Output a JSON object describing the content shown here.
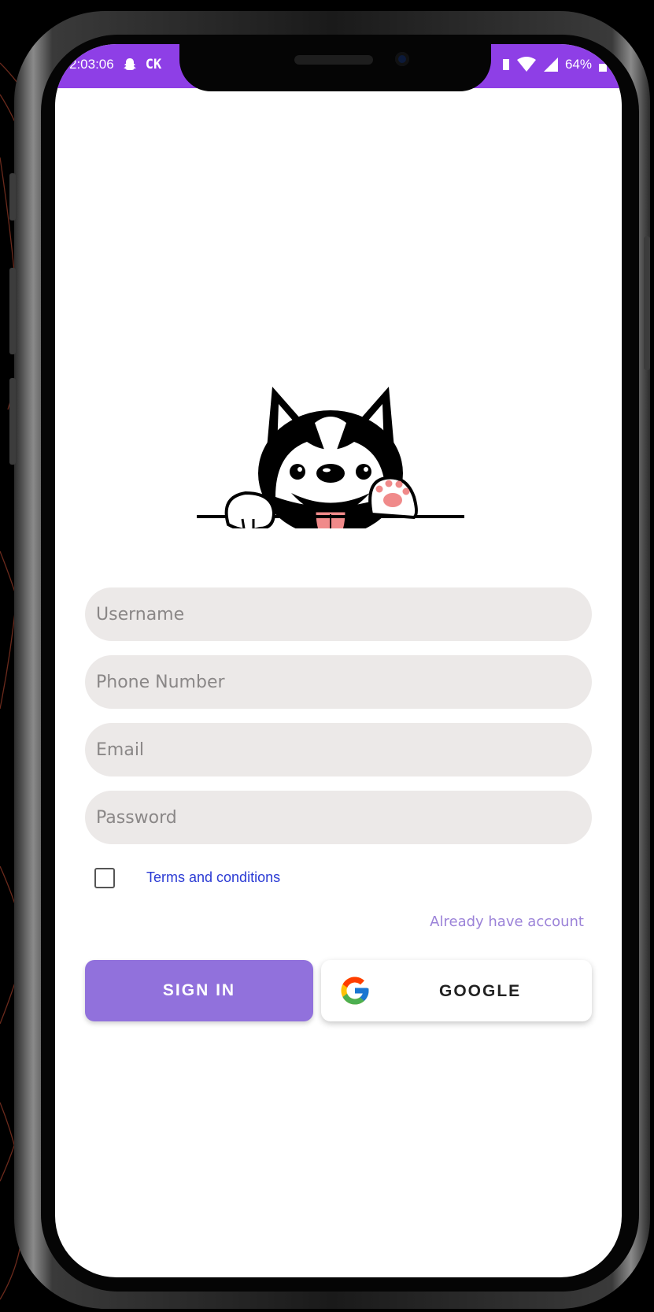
{
  "status_bar": {
    "time": "2:03:06",
    "carrier_tag": "CK",
    "battery": "64%",
    "icons": [
      "snapchat-icon",
      "sim-icon",
      "wifi-icon",
      "signal-icon",
      "battery-icon"
    ],
    "color": "#8e3fe6"
  },
  "logo": {
    "icon": "husky-dog-logo"
  },
  "form": {
    "username_placeholder": "Username",
    "phone_placeholder": "Phone Number",
    "email_placeholder": "Email",
    "password_placeholder": "Password",
    "terms_checked": false,
    "terms_label": "Terms and conditions",
    "already_account_label": "Already have account"
  },
  "buttons": {
    "signin_label": "SIGN IN",
    "google_label": "GOOGLE",
    "google_icon": "google-g-icon",
    "accent": "#9171dc"
  }
}
